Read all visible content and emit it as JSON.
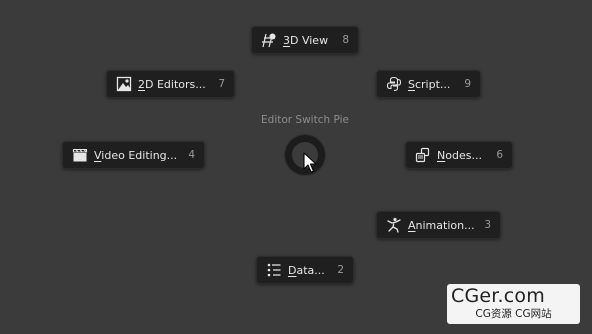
{
  "pie_menu": {
    "title": "Editor Switch Pie",
    "items": [
      {
        "label_pre": "",
        "label_ul": "3",
        "label_post": "D View",
        "key": "8",
        "icon": "3d-view-icon"
      },
      {
        "label_pre": "",
        "label_ul": "2",
        "label_post": "D Editors...",
        "key": "7",
        "icon": "image-editor-icon"
      },
      {
        "label_pre": "",
        "label_ul": "S",
        "label_post": "cript...",
        "key": "9",
        "icon": "python-script-icon"
      },
      {
        "label_pre": "",
        "label_ul": "V",
        "label_post": "ideo Editing...",
        "key": "4",
        "icon": "clapperboard-icon"
      },
      {
        "label_pre": "",
        "label_ul": "N",
        "label_post": "odes...",
        "key": "6",
        "icon": "node-editor-icon"
      },
      {
        "label_pre": "",
        "label_ul": "A",
        "label_post": "nimation...",
        "key": "3",
        "icon": "animation-figure-icon"
      },
      {
        "label_pre": "",
        "label_ul": "D",
        "label_post": "ata...",
        "key": "2",
        "icon": "outliner-list-icon"
      }
    ]
  },
  "watermark": {
    "main": "CGer.com",
    "sub": "CG资源 CG网站"
  }
}
